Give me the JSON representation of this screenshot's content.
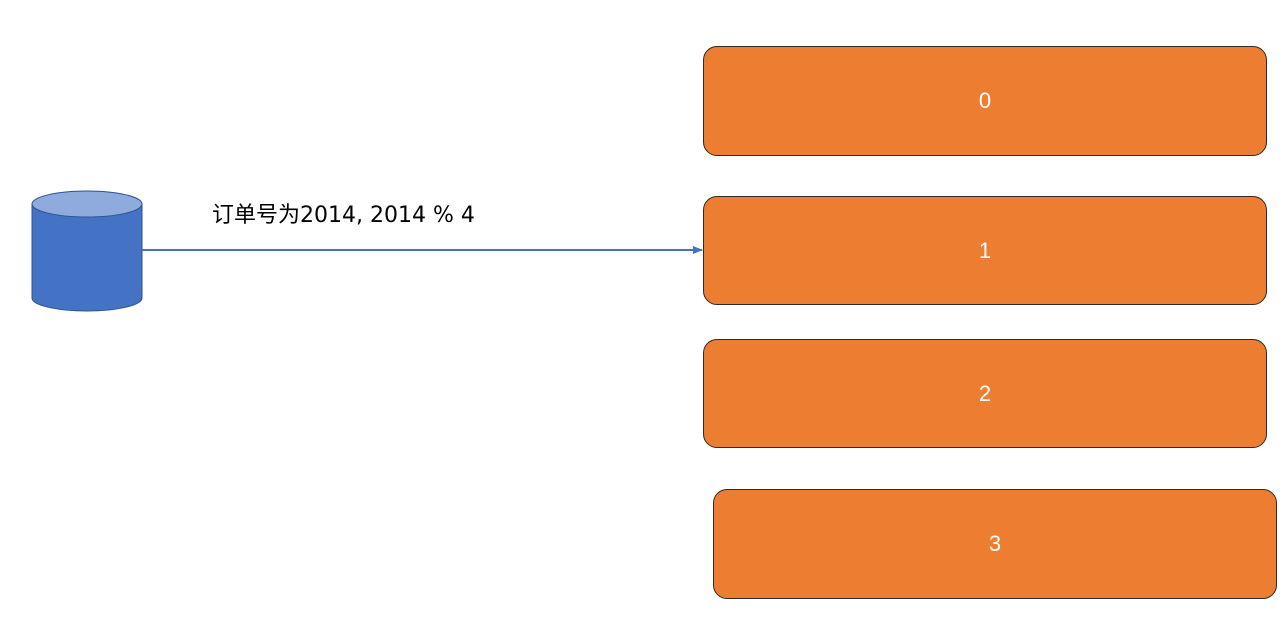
{
  "diagram": {
    "source": {
      "icon": "database-cylinder-icon"
    },
    "arrow": {
      "label": "订单号为2014, 2014 % 4"
    },
    "buckets": [
      {
        "label": "0"
      },
      {
        "label": "1"
      },
      {
        "label": "2"
      },
      {
        "label": "3"
      }
    ],
    "colors": {
      "bucket_fill": "#ED7D31",
      "bucket_border": "#2B2B2B",
      "cylinder_body": "#4472C4",
      "cylinder_top": "#8FAADC",
      "cylinder_stroke": "#2F528F",
      "arrow": "#4472C4"
    }
  }
}
